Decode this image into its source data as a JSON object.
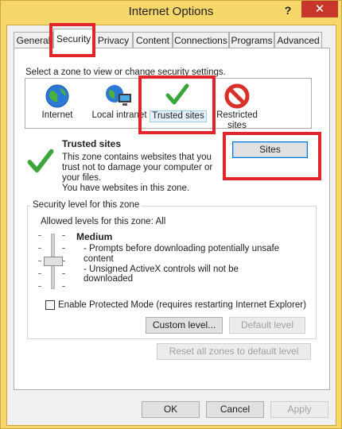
{
  "window": {
    "title": "Internet Options",
    "help_label": "?",
    "close_label": "✕"
  },
  "tabs": [
    {
      "label": "General"
    },
    {
      "label": "Security"
    },
    {
      "label": "Privacy"
    },
    {
      "label": "Content"
    },
    {
      "label": "Connections"
    },
    {
      "label": "Programs"
    },
    {
      "label": "Advanced"
    }
  ],
  "security": {
    "zone_prompt": "Select a zone to view or change security settings.",
    "zones": [
      {
        "label": "Internet",
        "icon": "globe-icon"
      },
      {
        "label": "Local intranet",
        "icon": "local-intranet-icon"
      },
      {
        "label": "Trusted sites",
        "icon": "checkmark-icon"
      },
      {
        "label": "Restricted sites",
        "icon": "restricted-icon"
      }
    ],
    "selected_zone": {
      "title": "Trusted sites",
      "description": "This zone contains websites that you trust not to damage your computer or your files.",
      "note": "You have websites in this zone."
    },
    "sites_button": "Sites",
    "security_level": {
      "group_title": "Security level for this zone",
      "allowed_label": "Allowed levels for this zone: All",
      "level_name": "Medium",
      "bullets": [
        "- Prompts before downloading potentially unsafe content",
        "- Unsigned ActiveX controls will not be downloaded"
      ],
      "slider_level": "Medium"
    },
    "protected_mode": {
      "label": "Enable Protected Mode (requires restarting Internet Explorer)",
      "checked": false
    },
    "custom_level_button": "Custom level...",
    "default_level_button": "Default level",
    "reset_all_button": "Reset all zones to default level"
  },
  "footer": {
    "ok": "OK",
    "cancel": "Cancel",
    "apply": "Apply"
  },
  "colors": {
    "title_bar": "#f6d76a",
    "close_button": "#c7352b",
    "highlight_annotation": "#e0262b",
    "selection": "#e5f1fb"
  }
}
